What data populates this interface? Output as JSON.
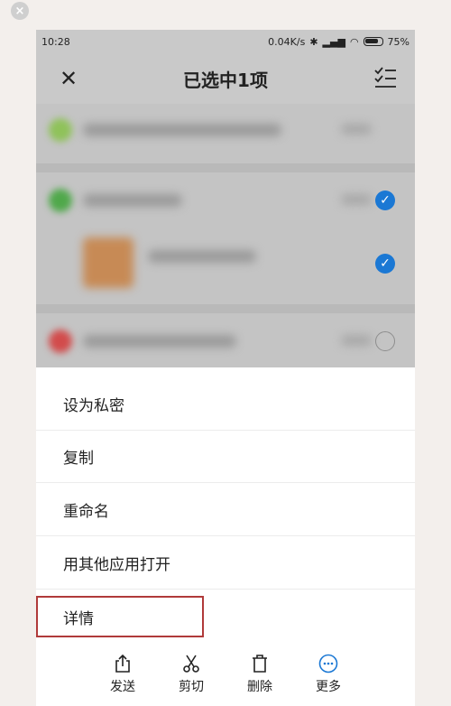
{
  "status_bar": {
    "time": "10:28",
    "net_speed": "0.04K/s",
    "battery": "75%"
  },
  "header": {
    "title": "已选中1项"
  },
  "menu": {
    "items": [
      {
        "label": "设为私密"
      },
      {
        "label": "复制"
      },
      {
        "label": "重命名"
      },
      {
        "label": "用其他应用打开"
      },
      {
        "label": "详情"
      }
    ]
  },
  "toolbar": {
    "items": [
      {
        "label": "发送",
        "icon": "share-icon"
      },
      {
        "label": "剪切",
        "icon": "scissors-icon"
      },
      {
        "label": "删除",
        "icon": "trash-icon"
      },
      {
        "label": "更多",
        "icon": "more-icon"
      }
    ]
  },
  "colors": {
    "accent": "#1b78d4",
    "highlight": "#b03a3a"
  }
}
